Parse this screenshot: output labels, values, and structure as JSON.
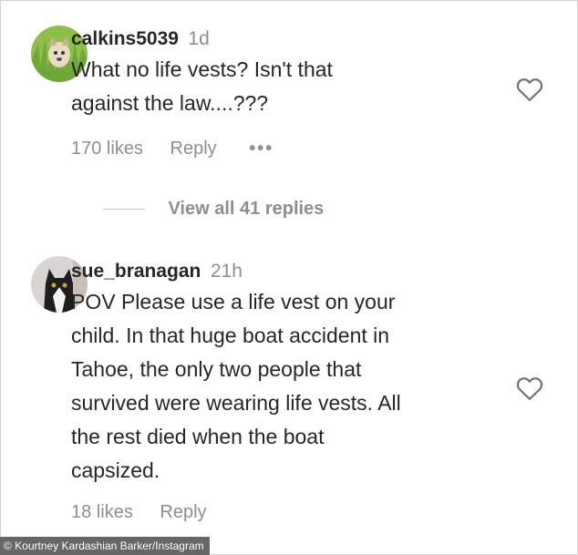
{
  "comments": [
    {
      "username": "calkins5039",
      "time": "1d",
      "lines": [
        "What no life vests? Isn't that",
        "against the law....???"
      ],
      "likes": "170 likes",
      "reply_label": "Reply",
      "more_label": "•••",
      "avatar_icon": "dog-on-grass-avatar",
      "like_icon": "heart-outline-icon"
    },
    {
      "username": "sue_branagan",
      "time": "21h",
      "lines": [
        "POV Please use a life vest on your",
        "child. In that huge boat accident in",
        "Tahoe, the only two people that",
        "survived were wearing life vests. All",
        "the rest died when the boat",
        "capsized."
      ],
      "likes": "18 likes",
      "reply_label": "Reply",
      "avatar_icon": "cat-avatar",
      "like_icon": "heart-outline-icon"
    }
  ],
  "view_replies": "View all 41 replies",
  "credit": "© Kourtney Kardashian Barker/Instagram",
  "colors": {
    "text": "#262626",
    "secondary": "#8e8e8e",
    "credit_bg": "#666666"
  }
}
